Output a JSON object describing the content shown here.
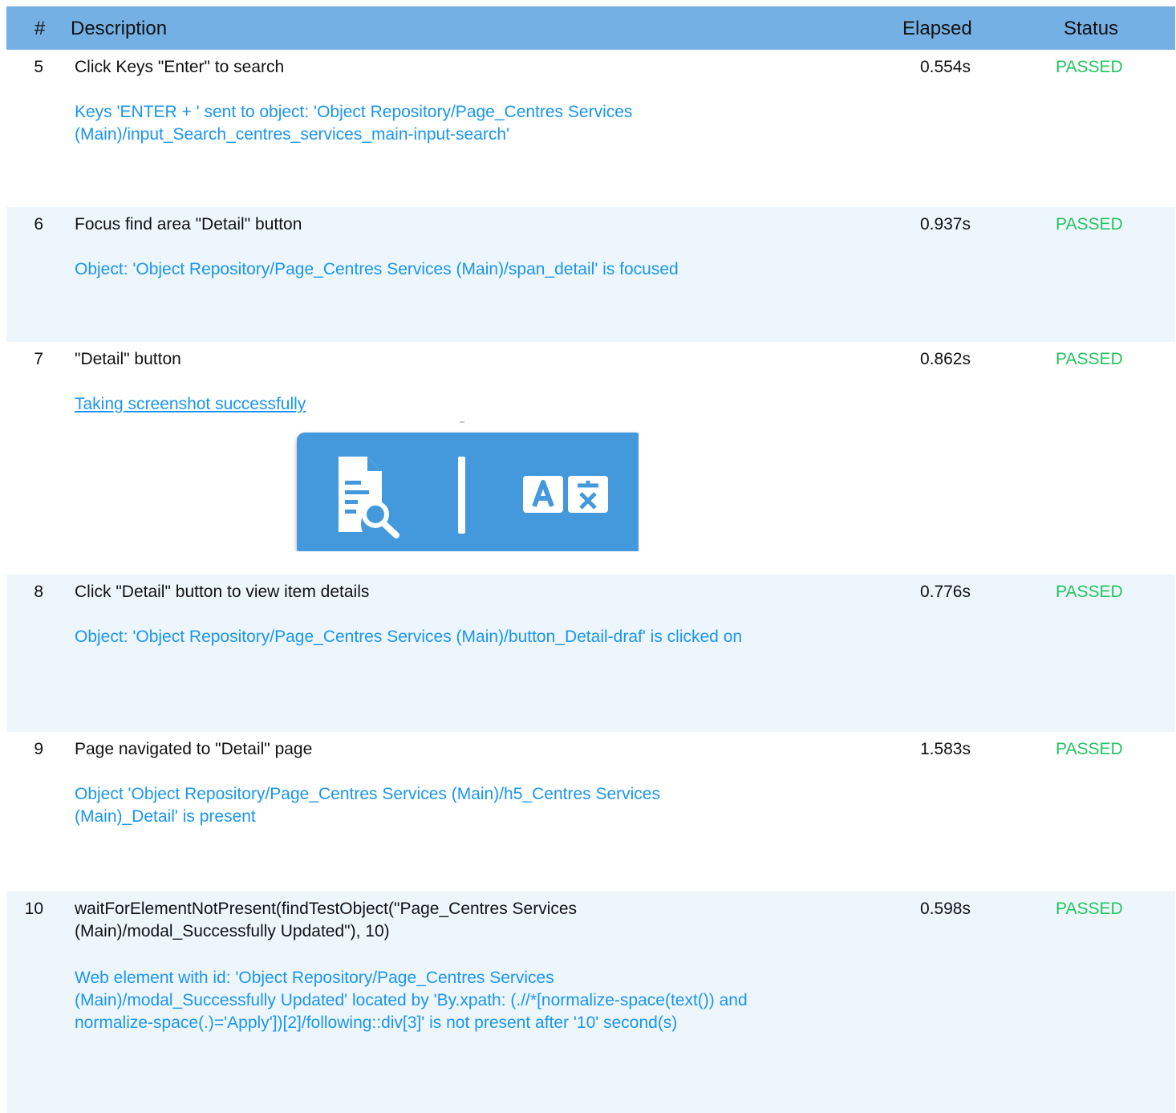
{
  "header": {
    "num": "#",
    "description": "Description",
    "elapsed": "Elapsed",
    "status": "Status"
  },
  "rows": [
    {
      "num": "5",
      "title": "Click Keys \"Enter\" to search",
      "log": [
        "Keys 'ENTER + ' sent to object: 'Object Repository/Page_Centres  Services",
        "(Main)/input_Search_centres_services_main-input-search'"
      ],
      "elapsed": "0.554s",
      "status": "PASSED"
    },
    {
      "num": "6",
      "title": "Focus find area \"Detail\" button",
      "log": [
        "Object: 'Object Repository/Page_Centres  Services (Main)/span_detail' is focused"
      ],
      "elapsed": "0.937s",
      "status": "PASSED"
    },
    {
      "num": "7",
      "title": "\"Detail\" button",
      "log": [
        "Taking screenshot successfully"
      ],
      "elapsed": "0.862s",
      "status": "PASSED"
    },
    {
      "num": "8",
      "title": "Click \"Detail\" button to view item details",
      "log": [
        "Object: 'Object Repository/Page_Centres  Services (Main)/button_Detail-draf' is clicked on"
      ],
      "elapsed": "0.776s",
      "status": "PASSED"
    },
    {
      "num": "9",
      "title": "Page navigated to \"Detail\" page",
      "log": [
        "Object 'Object Repository/Page_Centres  Services (Main)/h5_Centres  Services",
        "(Main)_Detail' is present"
      ],
      "elapsed": "1.583s",
      "status": "PASSED"
    },
    {
      "num": "10",
      "title": [
        "waitForElementNotPresent(findTestObject(\"Page_Centres  Services",
        "(Main)/modal_Successfully Updated\"), 10)"
      ],
      "log": [
        "Web element with id: 'Object Repository/Page_Centres  Services",
        "(Main)/modal_Successfully Updated' located by 'By.xpath: (.//*[normalize-space(text()) and",
        "normalize-space(.)='Apply'])[2]/following::div[3]' is not present after '10' second(s)"
      ],
      "elapsed": "0.598s",
      "status": "PASSED"
    }
  ],
  "screenshot": {
    "icons": [
      "document-search-icon",
      "translate-icon"
    ]
  },
  "colors": {
    "header_bg": "#74b0e4",
    "alt_row_bg": "#eef6fd",
    "log_text": "#1a95f2",
    "status_passed": "#22c55e",
    "toolbar_bg": "#4499dd"
  }
}
